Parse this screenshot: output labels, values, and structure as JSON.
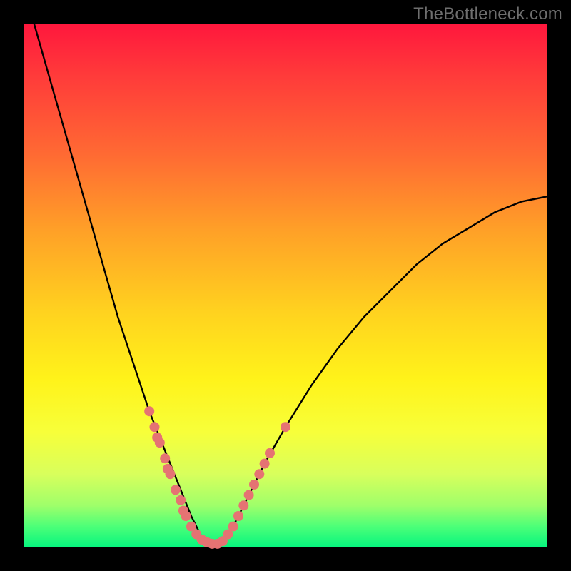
{
  "watermark": "TheBottleneck.com",
  "chart_data": {
    "type": "line",
    "title": "",
    "xlabel": "",
    "ylabel": "",
    "xlim": [
      0,
      100
    ],
    "ylim": [
      0,
      100
    ],
    "grid": false,
    "series": [
      {
        "name": "bottleneck-curve",
        "color": "#000000",
        "x": [
          2,
          4,
          6,
          8,
          10,
          12,
          14,
          16,
          18,
          20,
          22,
          24,
          26,
          28,
          30,
          32,
          33,
          34,
          35,
          36,
          37,
          38,
          40,
          42,
          44,
          46,
          50,
          55,
          60,
          65,
          70,
          75,
          80,
          85,
          90,
          95,
          100
        ],
        "values": [
          100,
          93,
          86,
          79,
          72,
          65,
          58,
          51,
          44,
          38,
          32,
          26,
          21,
          16,
          11,
          6,
          4,
          2,
          1,
          0.5,
          0.5,
          1,
          4,
          8,
          12,
          16,
          23,
          31,
          38,
          44,
          49,
          54,
          58,
          61,
          64,
          66,
          67
        ]
      }
    ],
    "markers": {
      "name": "highlight-dots",
      "color": "#e57373",
      "radius": 7,
      "points": [
        {
          "x": 24,
          "y": 26
        },
        {
          "x": 25,
          "y": 23
        },
        {
          "x": 25.5,
          "y": 21
        },
        {
          "x": 26,
          "y": 20
        },
        {
          "x": 27,
          "y": 17
        },
        {
          "x": 27.5,
          "y": 15
        },
        {
          "x": 28,
          "y": 14
        },
        {
          "x": 29,
          "y": 11
        },
        {
          "x": 30,
          "y": 9
        },
        {
          "x": 30.5,
          "y": 7
        },
        {
          "x": 31,
          "y": 6
        },
        {
          "x": 32,
          "y": 4
        },
        {
          "x": 33,
          "y": 2.5
        },
        {
          "x": 34,
          "y": 1.5
        },
        {
          "x": 35,
          "y": 1
        },
        {
          "x": 36,
          "y": 0.7
        },
        {
          "x": 37,
          "y": 0.7
        },
        {
          "x": 38,
          "y": 1.2
        },
        {
          "x": 39,
          "y": 2.5
        },
        {
          "x": 40,
          "y": 4
        },
        {
          "x": 41,
          "y": 6
        },
        {
          "x": 42,
          "y": 8
        },
        {
          "x": 43,
          "y": 10
        },
        {
          "x": 44,
          "y": 12
        },
        {
          "x": 45,
          "y": 14
        },
        {
          "x": 46,
          "y": 16
        },
        {
          "x": 47,
          "y": 18
        },
        {
          "x": 50,
          "y": 23
        }
      ]
    }
  }
}
